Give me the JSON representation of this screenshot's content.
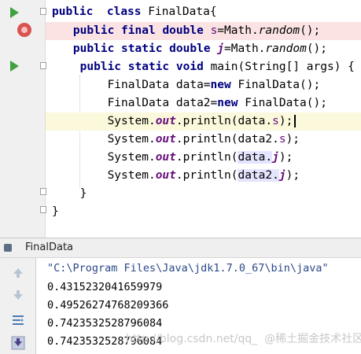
{
  "code": {
    "l1": {
      "k1": "public",
      "k2": "class",
      "name": "FinalData{"
    },
    "l2": {
      "k1": "public",
      "k2": "final",
      "k3": "double",
      "var": "s",
      "eq": "=Math.",
      "fn": "random",
      "tail": "();"
    },
    "l3": {
      "k1": "public",
      "k2": "static",
      "k3": "double",
      "var": "j",
      "eq": "=Math.",
      "fn": "random",
      "tail": "();"
    },
    "l4": {
      "k1": "public",
      "k2": "static",
      "k3": "void",
      "rest": "main(String[] args) {"
    },
    "l5": {
      "a": "FinalData data=",
      "kw": "new",
      "b": "FinalData();"
    },
    "l6": {
      "a": "FinalData data2=",
      "kw": "new",
      "b": "FinalData();"
    },
    "l7": {
      "a": "System.",
      "out": "out",
      "b": ".println(data.",
      "f": "s",
      "c": ");"
    },
    "l8": {
      "a": "System.",
      "out": "out",
      "b": ".println(data2.",
      "f": "s",
      "c": ");"
    },
    "l9": {
      "a": "System.",
      "out": "out",
      "b": ".println(",
      "box": "data.",
      "f": "j",
      "c": ");"
    },
    "l10": {
      "a": "System.",
      "out": "out",
      "b": ".println(",
      "box": "data2.",
      "f": "j",
      "c": ");"
    },
    "l11": "}",
    "l12": "}"
  },
  "run_panel": {
    "title": "FinalData",
    "command": "\"C:\\Program Files\\Java\\jdk1.7.0_67\\bin\\java\"",
    "output": [
      "0.4315232041659979",
      "0.49526274768209366",
      "0.7423532528796084",
      "0.7423532528796084"
    ]
  },
  "watermark": "http://blog.csdn.net/qq_  @稀土掘金技术社区",
  "colors": {
    "keyword": "#000080",
    "field": "#660e7a",
    "run": "#3fa142",
    "breakpoint": "#d9534f"
  },
  "icons": [
    "run-icon",
    "breakpoint-icon",
    "fold-icon",
    "rerun-icon",
    "stop-icon",
    "wrap-icon",
    "scroll-down-icon"
  ]
}
